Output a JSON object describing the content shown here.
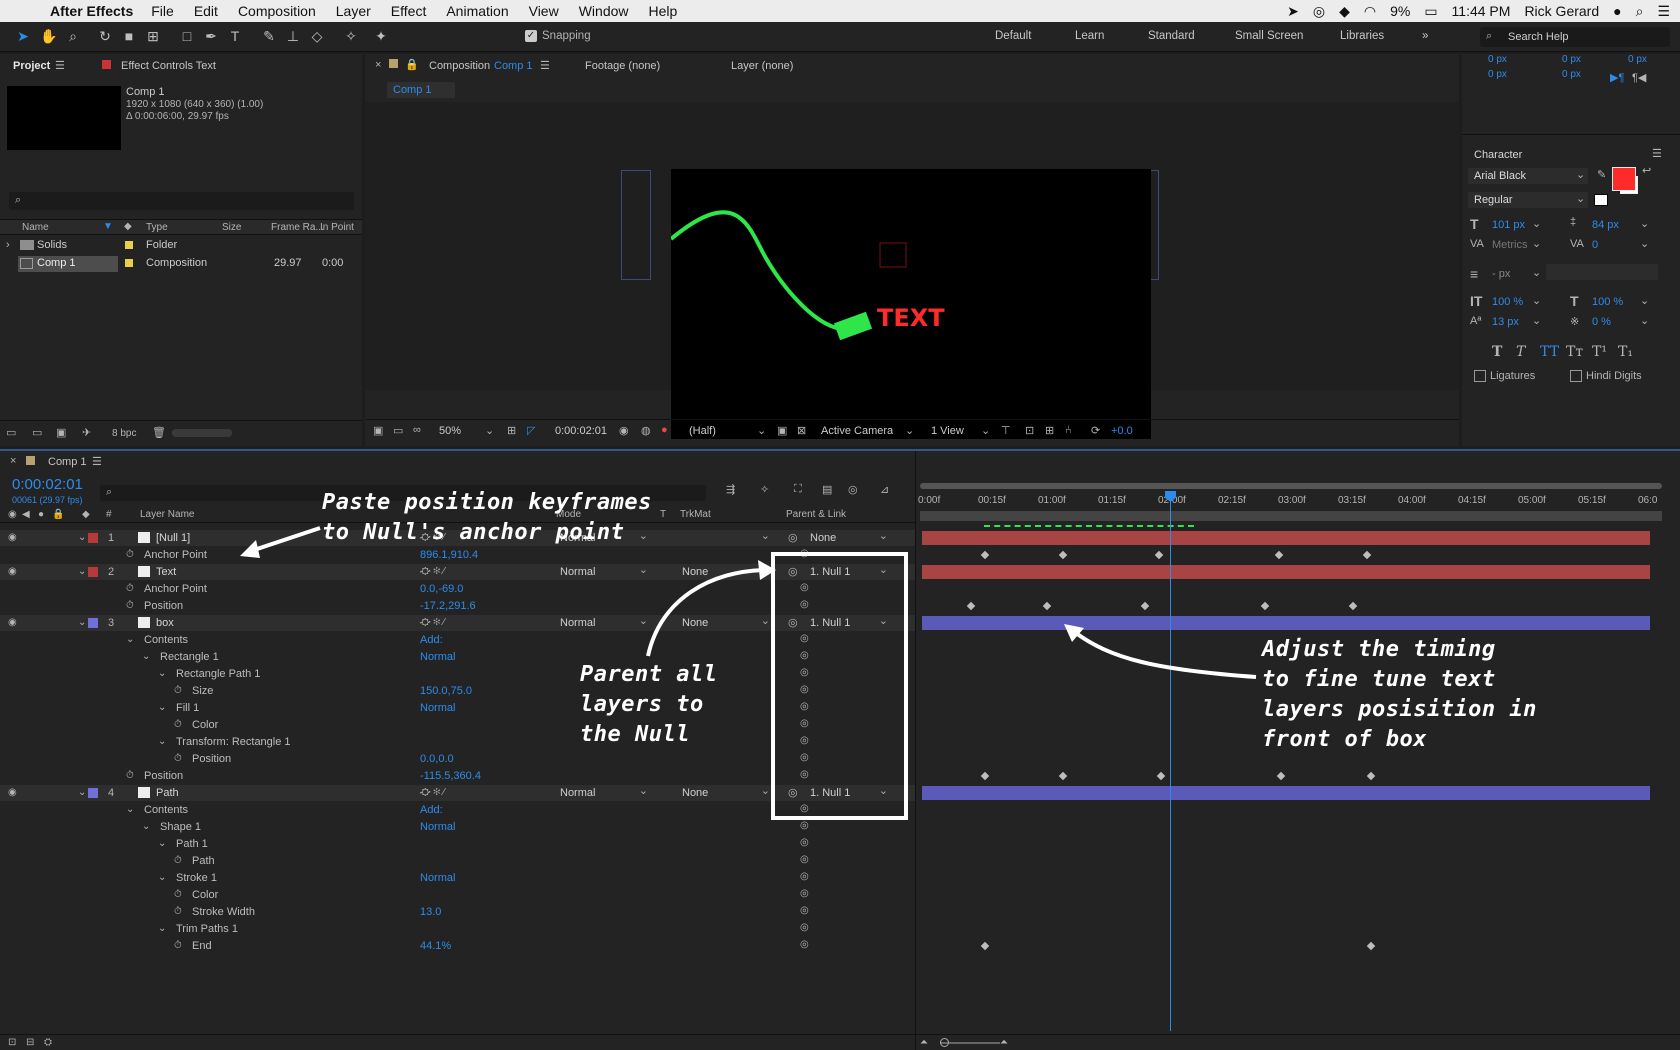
{
  "menubar": {
    "app_name": "After Effects",
    "items": [
      "File",
      "Edit",
      "Composition",
      "Layer",
      "Effect",
      "Animation",
      "View",
      "Window",
      "Help"
    ],
    "battery": "9%",
    "clock": "11:44 PM",
    "user": "Rick Gerard"
  },
  "toolbar": {
    "snapping_label": "Snapping",
    "workspaces": [
      "Default",
      "Learn",
      "Standard",
      "Small Screen",
      "Libraries"
    ],
    "search_placeholder": "Search Help"
  },
  "project": {
    "tab_project": "Project",
    "tab_effect_controls": "Effect Controls Text",
    "comp_name": "Comp 1",
    "comp_info_1": "1920 x 1080  (640 x 360) (1.00)",
    "comp_info_2": "Δ 0:00:06:00, 29.97 fps",
    "columns": [
      "Name",
      "Type",
      "Size",
      "Frame Ra...",
      "In Point"
    ],
    "items": [
      {
        "name": "Solids",
        "type": "Folder",
        "size": "",
        "fps": "",
        "in": "",
        "color": "#e6cf4a"
      },
      {
        "name": "Comp 1",
        "type": "Composition",
        "size": "",
        "fps": "29.97",
        "in": "0:00",
        "color": "#e6cf4a"
      }
    ],
    "bpc": "8 bpc"
  },
  "viewer": {
    "tab_comp_prefix": "Composition",
    "tab_comp_name": "Comp 1",
    "tab_footage": "Footage (none)",
    "tab_layer": "Layer (none)",
    "flow_tab": "Comp 1",
    "canvas_text": "TEXT",
    "zoom": "50%",
    "timecode": "0:00:02:01",
    "resolution": "(Half)",
    "camera": "Active Camera",
    "views": "1 View",
    "exposure": "+0.0"
  },
  "character": {
    "offsets": [
      "0 px",
      "0 px",
      "0 px",
      "0 px",
      "0 px"
    ],
    "title": "Character",
    "font": "Arial Black",
    "style": "Regular",
    "size": "101 px",
    "leading": "84 px",
    "kerning": "Metrics",
    "tracking": "0",
    "stroke": "- px",
    "vscale": "100 %",
    "hscale": "100 %",
    "baseline": "13 px",
    "tsume": "0 %",
    "ligatures": "Ligatures",
    "hindi": "Hindi Digits",
    "fill_color": "#ff2a2a"
  },
  "timeline": {
    "tab": "Comp 1",
    "timecode": "0:00:02:01",
    "frame_info": "00061 (29.97 fps)",
    "col_layer_name": "Layer Name",
    "col_mode": "Mode",
    "col_t": "T",
    "col_trkmat": "TrkMat",
    "col_parent": "Parent & Link",
    "ruler": [
      "0:00f",
      "00:15f",
      "01:00f",
      "01:15f",
      "02:00f",
      "02:15f",
      "03:00f",
      "03:15f",
      "04:00f",
      "04:15f",
      "05:00f",
      "05:15f",
      "06:0"
    ],
    "rows": [
      {
        "num": "1",
        "name": "[Null 1]",
        "mode": "Normal",
        "trk": "",
        "parent": "None",
        "kind": "layer",
        "label": "#b73a3a"
      },
      {
        "name": "Anchor Point",
        "value": "896.1,910.4",
        "kind": "prop"
      },
      {
        "num": "2",
        "name": "Text",
        "mode": "Normal",
        "trk": "None",
        "parent": "1. Null 1",
        "kind": "layer",
        "label": "#b73a3a"
      },
      {
        "name": "Anchor Point",
        "value": "0.0,-69.0",
        "kind": "prop"
      },
      {
        "name": "Position",
        "value": "-17.2,291.6",
        "kind": "prop"
      },
      {
        "num": "3",
        "name": "box",
        "mode": "Normal",
        "trk": "None",
        "parent": "1. Null 1",
        "kind": "layer",
        "label": "#6f6fd8"
      },
      {
        "name": "Contents",
        "value": "Add:",
        "kind": "group"
      },
      {
        "name": "Rectangle 1",
        "value": "Normal",
        "kind": "group"
      },
      {
        "name": "Rectangle Path 1",
        "value": "",
        "kind": "group"
      },
      {
        "name": "Size",
        "value": "150.0,75.0",
        "kind": "prop"
      },
      {
        "name": "Fill 1",
        "value": "Normal",
        "kind": "group"
      },
      {
        "name": "Color",
        "value": "",
        "kind": "prop"
      },
      {
        "name": "Transform: Rectangle 1",
        "value": "",
        "kind": "group"
      },
      {
        "name": "Position",
        "value": "0.0,0.0",
        "kind": "prop"
      },
      {
        "name": "Position",
        "value": "-115.5,360.4",
        "kind": "prop"
      },
      {
        "num": "4",
        "name": "Path",
        "mode": "Normal",
        "trk": "None",
        "parent": "1. Null 1",
        "kind": "layer",
        "label": "#6f6fd8"
      },
      {
        "name": "Contents",
        "value": "Add:",
        "kind": "group"
      },
      {
        "name": "Shape 1",
        "value": "Normal",
        "kind": "group"
      },
      {
        "name": "Path 1",
        "value": "",
        "kind": "group"
      },
      {
        "name": "Path",
        "value": "",
        "kind": "prop"
      },
      {
        "name": "Stroke 1",
        "value": "Normal",
        "kind": "group"
      },
      {
        "name": "Color",
        "value": "",
        "kind": "prop"
      },
      {
        "name": "Stroke Width",
        "value": "13.0",
        "kind": "prop"
      },
      {
        "name": "Trim Paths 1",
        "value": "",
        "kind": "group"
      },
      {
        "name": "End",
        "value": "44.1%",
        "kind": "prop"
      }
    ]
  },
  "annotations": {
    "paste": "Paste position keyframes\nto Null's anchor point",
    "parent": "Parent all\nlayers to\nthe Null",
    "adjust": "Adjust the timing\nto fine tune text\nlayers posisition in\nfront of box"
  },
  "colors": {
    "accent": "#2d8ceb",
    "green": "#2ee64a",
    "red": "#ff2a2a"
  }
}
